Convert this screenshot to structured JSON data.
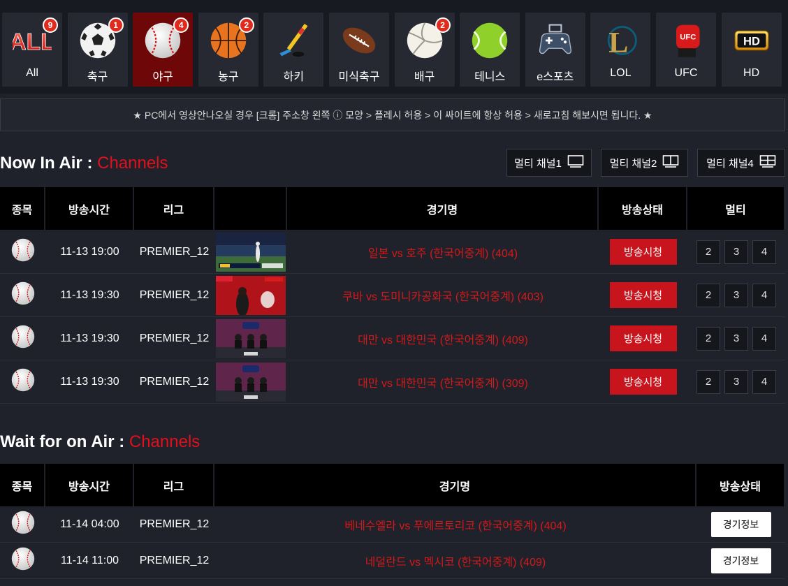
{
  "categories": [
    {
      "label": "All",
      "icon": "all-icon",
      "badge": "9"
    },
    {
      "label": "축구",
      "icon": "soccer-ball-icon",
      "badge": "1"
    },
    {
      "label": "야구",
      "icon": "baseball-icon",
      "badge": "4",
      "active": true
    },
    {
      "label": "농구",
      "icon": "basketball-icon",
      "badge": "2"
    },
    {
      "label": "하키",
      "icon": "hockey-stick-icon",
      "badge": ""
    },
    {
      "label": "미식축구",
      "icon": "american-football-icon",
      "badge": ""
    },
    {
      "label": "배구",
      "icon": "volleyball-icon",
      "badge": "2"
    },
    {
      "label": "테니스",
      "icon": "tennis-ball-icon",
      "badge": ""
    },
    {
      "label": "e스포츠",
      "icon": "gamepad-icon",
      "badge": ""
    },
    {
      "label": "LOL",
      "icon": "lol-logo-icon",
      "badge": ""
    },
    {
      "label": "UFC",
      "icon": "ufc-glove-icon",
      "badge": ""
    },
    {
      "label": "HD",
      "icon": "hd-icon",
      "badge": ""
    }
  ],
  "all_icon_text": "ALL",
  "hd_icon_text": "HD",
  "lol_icon_text": "L",
  "ufc_icon_text": "UFC",
  "notice": "★ PC에서 영상안나오실 경우 [크롬] 주소창 왼쪽 ⓘ 모양 > 플레시 허용 > 이 싸이트에 항상 허용 > 새로고침 해보시면 됩니다. ★",
  "now_section": {
    "title": "Now In Air : ",
    "title_accent": "Channels",
    "multi_buttons": [
      "멀티 채널1",
      "멀티 채널2",
      "멀티 채널4"
    ],
    "headers": [
      "종목",
      "방송시간",
      "리그",
      "",
      "경기명",
      "방송상태",
      "멀티"
    ],
    "rows": [
      {
        "time": "11-13 19:00",
        "league": "PREMIER_12",
        "game": "일본 vs 호주 (한국어중계) (404)",
        "status": "방송시청",
        "multi": [
          "2",
          "3",
          "4"
        ],
        "thumb": "field"
      },
      {
        "time": "11-13 19:30",
        "league": "PREMIER_12",
        "game": "쿠바 vs 도미니카공화국 (한국어중계) (403)",
        "status": "방송시청",
        "multi": [
          "2",
          "3",
          "4"
        ],
        "thumb": "studio-red"
      },
      {
        "time": "11-13 19:30",
        "league": "PREMIER_12",
        "game": "대만 vs 대한민국 (한국어중계) (409)",
        "status": "방송시청",
        "multi": [
          "2",
          "3",
          "4"
        ],
        "thumb": "studio-desk"
      },
      {
        "time": "11-13 19:30",
        "league": "PREMIER_12",
        "game": "대만 vs 대한민국 (한국어중계) (309)",
        "status": "방송시청",
        "multi": [
          "2",
          "3",
          "4"
        ],
        "thumb": "studio-desk"
      }
    ]
  },
  "wait_section": {
    "title": "Wait for on Air : ",
    "title_accent": "Channels",
    "headers": [
      "종목",
      "방송시간",
      "리그",
      "경기명",
      "방송상태"
    ],
    "rows": [
      {
        "time": "11-14 04:00",
        "league": "PREMIER_12",
        "game": "베네수엘라 vs 푸에르토리코 (한국어중계) (404)",
        "status": "경기정보"
      },
      {
        "time": "11-14 11:00",
        "league": "PREMIER_12",
        "game": "네덜란드 vs 멕시코 (한국어중계) (409)",
        "status": "경기정보"
      }
    ]
  },
  "colors": {
    "accent": "#e0101c",
    "watch_button": "#c8141c",
    "badge": "#e02a1c",
    "active_category": "#6e0808"
  }
}
